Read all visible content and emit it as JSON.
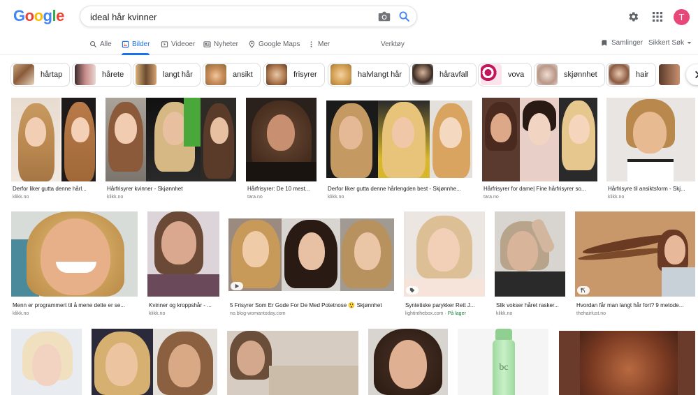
{
  "logo": [
    "G",
    "o",
    "o",
    "g",
    "l",
    "e"
  ],
  "logo_colors": [
    "#4285f4",
    "#ea4335",
    "#fbbc05",
    "#4285f4",
    "#34a853",
    "#ea4335"
  ],
  "search": {
    "query": "ideal hår kvinner"
  },
  "avatar_letter": "T",
  "tabs": {
    "all": "Alle",
    "images": "Bilder",
    "videos": "Videoer",
    "news": "Nyheter",
    "maps": "Google Maps",
    "more": "Mer",
    "tools": "Verktøy",
    "collections": "Samlinger",
    "safesearch": "Sikkert Søk"
  },
  "chips": [
    "hårtap",
    "hårete",
    "langt hår",
    "ansikt",
    "frisyrer",
    "halvlangt hår",
    "håravfall",
    "vova",
    "skjønnhet",
    "hair"
  ],
  "results": [
    {
      "caption": "Derfor liker gutta denne hårl...",
      "source": "klikk.no"
    },
    {
      "caption": "Hårfrisyrer kvinner - Skjønnhet",
      "source": "klikk.no"
    },
    {
      "caption": "Hårfrisyrer: De 10 mest...",
      "source": "tara.no"
    },
    {
      "caption": "Derfor liker gutta denne hårlengden best - Skjønnhe...",
      "source": "klikk.no"
    },
    {
      "caption": "Hårfrisyrer for dame| Fine hårfrisyrer so...",
      "source": "tara.no"
    },
    {
      "caption": "Hårfrisyre til ansiktsform - Skj...",
      "source": "klikk.no"
    },
    {
      "caption": "Menn er programmert til å mene dette er se...",
      "source": "klikk.no"
    },
    {
      "caption": "Kvinner og kroppshår - ...",
      "source": "klikk.no"
    },
    {
      "caption": "5 Frisyrer Som Er Gode For De Med Potetnose 😲 Skjønnhet",
      "source": "no.blog-womantoday.com"
    },
    {
      "caption": "Syntetiske parykker Rett J...",
      "source": "lightinthebox.com",
      "extra": "På lager"
    },
    {
      "caption": "Slik vokser håret rasker...",
      "source": "klikk.no"
    },
    {
      "caption": "Hvordan får man langt hår fort? 9 metode...",
      "source": "thehairlust.no"
    }
  ],
  "bottle_text": "bc"
}
